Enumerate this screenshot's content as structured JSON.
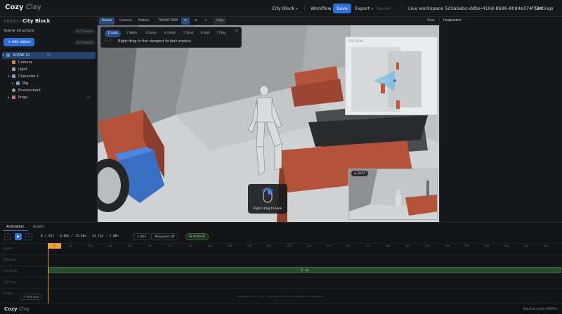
{
  "app": {
    "logo_main": "Cozy",
    "logo_accent": "Clay"
  },
  "topbar": {
    "scene_selector": "City Block",
    "workflow": "Workflow",
    "save": "Save",
    "export": "Export",
    "saves": "Saves",
    "workspace": "Live workspace 5d3abebc-ddbe-410d-8b96-80d4e374f734",
    "settings": "Settings"
  },
  "left": {
    "project_label": "PROJECT",
    "project_name": "City Block",
    "scene_structure": "Scene structure",
    "frames_chip": "417 frames",
    "add_object": "Add object",
    "add_chip": "417 frames",
    "tree": [
      {
        "label": "SCENE 01",
        "badge": "01",
        "selected": true,
        "color": "#6e8fb8"
      },
      {
        "label": "Camera",
        "color": "#d98a3d"
      },
      {
        "label": "Light",
        "color": "#9aa0a6"
      },
      {
        "label": "Character 1",
        "color": "#7aa0c8"
      },
      {
        "label": "Big",
        "color": "#7aa0c8"
      },
      {
        "label": "Environment",
        "color": "#8fa79b"
      },
      {
        "label": "Props",
        "badge": "14",
        "color": "#c86c6c"
      }
    ]
  },
  "viewport_toolbar": {
    "tabs": [
      "Scene",
      "Camera",
      "Motion",
      "TRANSFORM"
    ],
    "help": "Help",
    "view": "View"
  },
  "nav_modes": {
    "modes": [
      "Look",
      "Walk",
      "Dolly",
      "Orbit",
      "Shot",
      "Rail",
      "Play"
    ],
    "active": "Look",
    "hint_index": "1 · 7",
    "hint": "Right-drag in the viewport to look around.",
    "close": "×"
  },
  "overlays": {
    "minimap_label": "TOP VIEW",
    "pip_label": "SHOT",
    "rdrag_label": "Right-drag to look"
  },
  "inspector": {
    "title": "Inspector"
  },
  "timeline": {
    "tabs": [
      "Animation",
      "Assets"
    ],
    "readout": "0 / 431 · 0.00s / 13.60s · 24 fps · 1.00×",
    "speed": "1.00×",
    "waypoint": "Waypoint off",
    "playback": "PLAYBACK",
    "ticks": [
      "0",
      "16",
      "48",
      "64",
      "80",
      "96",
      "112",
      "128",
      "144",
      "160",
      "176",
      "192",
      "208",
      "224",
      "240",
      "256",
      "272",
      "288",
      "304",
      "320",
      "336",
      "352",
      "368",
      "384",
      "400",
      "416"
    ],
    "rows": [
      "Sheet",
      "Prompts",
      "Cut Body",
      "3D Pose",
      "Shots"
    ],
    "clip_label": "1 · 1s",
    "playhead_label": "0",
    "add_shot": "+ Add shot",
    "empty_msg": "No shots yet — use + Add shot in the lane header to create one."
  },
  "footer": {
    "source": "Source code (AGPL)"
  }
}
